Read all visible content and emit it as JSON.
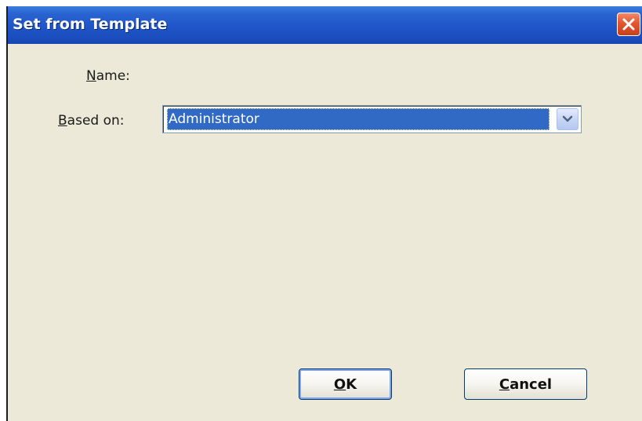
{
  "dialog": {
    "title": "Set from Template",
    "close_icon": "close-icon"
  },
  "form": {
    "name_label_mnemonic": "N",
    "name_label_rest": "ame:",
    "based_on_label_mnemonic": "B",
    "based_on_label_rest": "ased on:",
    "based_on_value": "Administrator",
    "dropdown_icon": "chevron-down-icon"
  },
  "buttons": {
    "ok_mnemonic": "O",
    "ok_rest": "K",
    "cancel_mnemonic": "C",
    "cancel_rest": "ancel"
  },
  "colors": {
    "titlebar": "#1f55c8",
    "dialog_bg": "#ece9d8",
    "selection": "#316ac5",
    "close_button": "#e2562f"
  }
}
